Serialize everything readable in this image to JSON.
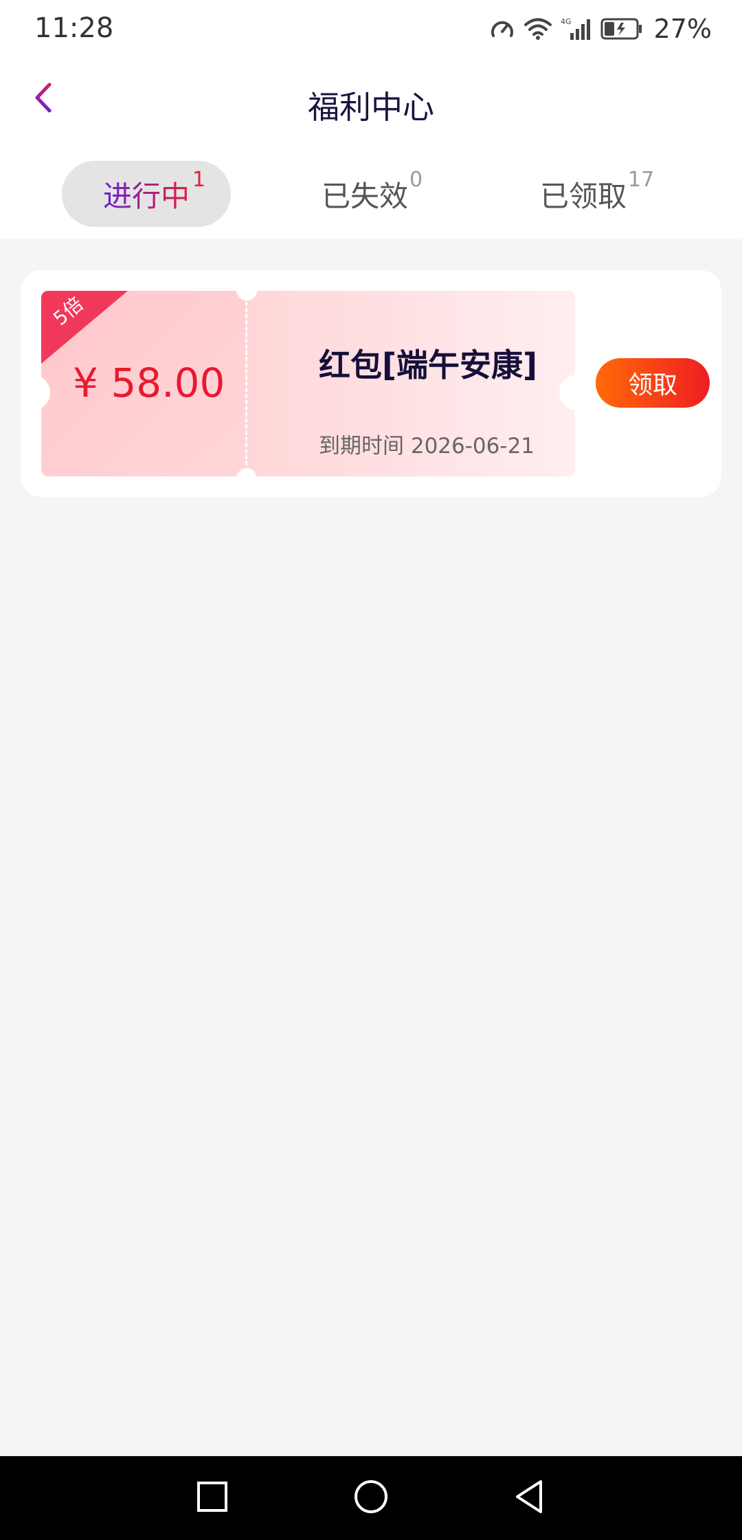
{
  "status_bar": {
    "time": "11:28",
    "battery": "27%",
    "icons": [
      "speedometer-icon",
      "wifi-icon",
      "signal-4g-icon",
      "battery-charging-icon"
    ]
  },
  "header": {
    "title": "福利中心",
    "back_icon": "chevron-left-icon",
    "accent_color": "#9b1f7a"
  },
  "tabs": [
    {
      "label": "进行中",
      "count": "1",
      "active": true
    },
    {
      "label": "已失效",
      "count": "0",
      "active": false
    },
    {
      "label": "已领取",
      "count": "17",
      "active": false
    }
  ],
  "coupon": {
    "multiplier_badge": "5倍",
    "amount": "¥ 58.00",
    "title": "红包[端午安康]",
    "expiry": "到期时间 2026-06-21",
    "claim_label": "领取",
    "amount_color": "#e8192f",
    "button_color": "#f0401c"
  },
  "nav_bar": {
    "icons": [
      "recent-apps-icon",
      "home-icon",
      "back-triangle-icon"
    ]
  }
}
